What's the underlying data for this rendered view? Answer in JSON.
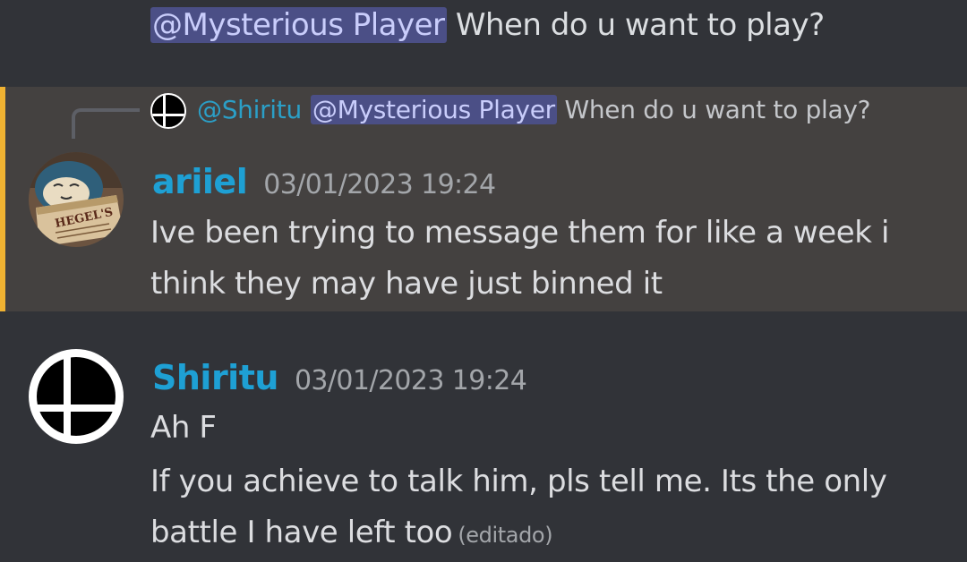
{
  "top_message": {
    "mention": "@Mysterious Player",
    "text": "When do u want to play?"
  },
  "ariiel_message": {
    "reply": {
      "author": "@Shiritu",
      "mention": "@Mysterious Player",
      "text": "When do u want to play?"
    },
    "author": "ariiel",
    "timestamp": "03/01/2023 19:24",
    "text": "Ive been trying to message them for like a week i think they may have just binned it",
    "avatar_caption": "HEGEL'S"
  },
  "shiritu_message": {
    "author": "Shiritu",
    "timestamp": "03/01/2023 19:24",
    "line1": "Ah F",
    "line2": "If you achieve to talk him, pls tell me. Its the only",
    "line3": "battle I have left too",
    "edited": "(editado)"
  },
  "colors": {
    "background": "#313338",
    "highlight_background": "#444140",
    "highlight_bar": "#f0b232",
    "author_blue": "#1ea0d4",
    "mention_bg": "#4b4f86",
    "mention_text": "#c9cdfb"
  },
  "icons": {
    "shiritu_avatar": "smash-bros-logo-icon",
    "ariiel_avatar": "snorlax-reading-avatar"
  }
}
